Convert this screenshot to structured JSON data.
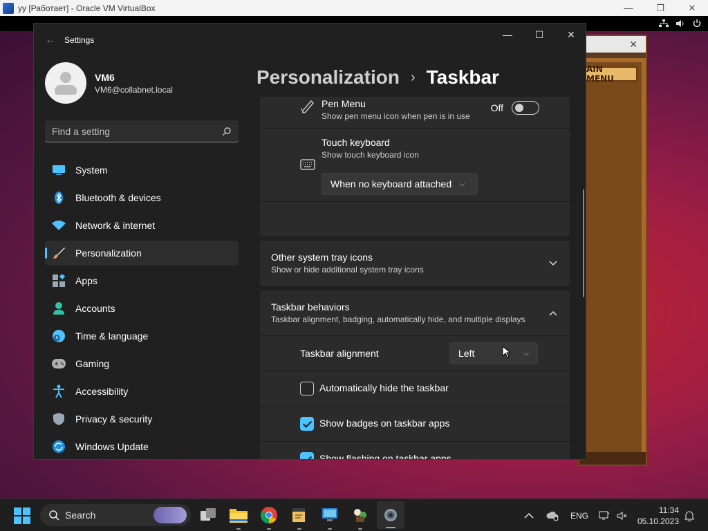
{
  "vbox": {
    "title": "уу [Работает] - Oracle VM VirtualBox",
    "minimize": "—",
    "maximize": "❐",
    "close": "✕"
  },
  "game": {
    "main_menu": "AIN MENU",
    "close": "✕"
  },
  "settings": {
    "window_title": "Settings",
    "back": "←",
    "controls": {
      "minimize": "—",
      "maximize": "☐",
      "close": "✕"
    },
    "profile": {
      "name": "VM6",
      "email": "VM6@collabnet.local"
    },
    "search": {
      "placeholder": "Find a setting"
    },
    "nav": [
      {
        "label": "System",
        "icon": "system-icon",
        "color": "#4cc2ff"
      },
      {
        "label": "Bluetooth & devices",
        "icon": "bluetooth-icon",
        "color": "#4cc2ff"
      },
      {
        "label": "Network & internet",
        "icon": "wifi-icon",
        "color": "#4cc2ff"
      },
      {
        "label": "Personalization",
        "icon": "brush-icon",
        "color": "#e8a16a",
        "active": true
      },
      {
        "label": "Apps",
        "icon": "apps-icon",
        "color": "#9aa7b5"
      },
      {
        "label": "Accounts",
        "icon": "person-icon",
        "color": "#2ec4a6"
      },
      {
        "label": "Time & language",
        "icon": "globe-clock-icon",
        "color": "#4cc2ff"
      },
      {
        "label": "Gaming",
        "icon": "gamepad-icon",
        "color": "#b0b0b0"
      },
      {
        "label": "Accessibility",
        "icon": "accessibility-icon",
        "color": "#4cc2ff"
      },
      {
        "label": "Privacy & security",
        "icon": "shield-icon",
        "color": "#9aa7b5"
      },
      {
        "label": "Windows Update",
        "icon": "update-icon",
        "color": "#4cc2ff"
      }
    ],
    "breadcrumb": {
      "parent": "Personalization",
      "separator": "›",
      "current": "Taskbar"
    },
    "pen_menu": {
      "title": "Pen Menu",
      "subtitle": "Show pen menu icon when pen is in use",
      "state": "Off"
    },
    "touch_keyboard": {
      "title": "Touch keyboard",
      "subtitle": "Show touch keyboard icon",
      "dropdown": "When no keyboard attached"
    },
    "other_tray": {
      "title": "Other system tray icons",
      "subtitle": "Show or hide additional system tray icons"
    },
    "behaviors": {
      "title": "Taskbar behaviors",
      "subtitle": "Taskbar alignment, badging, automatically hide, and multiple displays",
      "alignment_label": "Taskbar alignment",
      "alignment_value": "Left",
      "auto_hide": {
        "label": "Automatically hide the taskbar",
        "checked": false
      },
      "badges": {
        "label": "Show badges on taskbar apps",
        "checked": true
      },
      "flashing": {
        "label": "Show flashing on taskbar apps",
        "checked": true
      }
    }
  },
  "taskbar": {
    "search_label": "Search",
    "apps": [
      "task-view-icon",
      "file-explorer-icon",
      "chrome-icon",
      "notepad-icon",
      "remote-desktop-icon",
      "game-icon",
      "settings-icon"
    ],
    "language": "ENG",
    "time": "11:34",
    "date": "05.10.2023"
  },
  "colors": {
    "accent": "#4cc2ff",
    "window_bg": "#202020",
    "card_bg": "#2b2b2b"
  }
}
